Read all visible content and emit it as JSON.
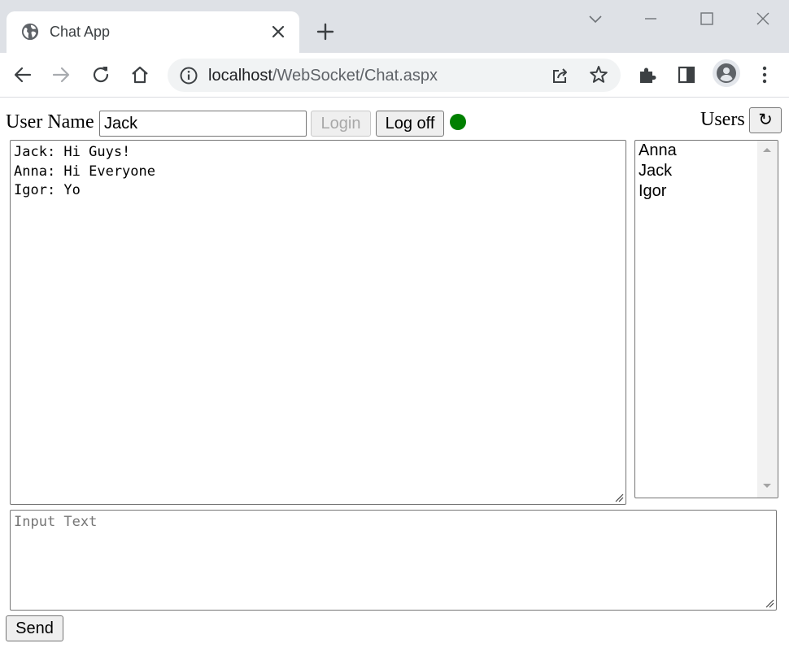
{
  "browser": {
    "tab_title": "Chat App",
    "url_host": "localhost",
    "url_path": "/WebSocket/Chat.aspx"
  },
  "page": {
    "username_label": "User Name",
    "username_value": "Jack",
    "login_label": "Login",
    "logoff_label": "Log off",
    "connection_status_color": "#008000",
    "users_label": "Users",
    "refresh_glyph": "↻",
    "messages": [
      "Jack: Hi Guys!",
      "Anna: Hi Everyone",
      "Igor: Yo"
    ],
    "users": [
      "Anna",
      "Jack",
      "Igor"
    ],
    "input_placeholder": "Input Text",
    "send_label": "Send"
  }
}
